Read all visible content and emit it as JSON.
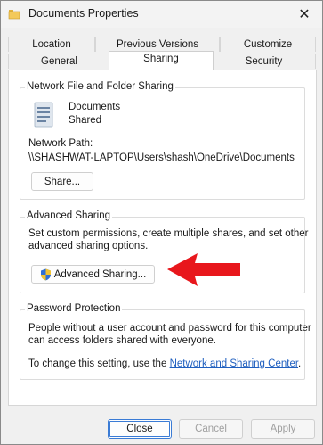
{
  "window": {
    "title": "Documents Properties",
    "close_glyph": "✕"
  },
  "tabs": {
    "row1": [
      "Location",
      "Previous Versions",
      "Customize"
    ],
    "row2": [
      "General",
      "Sharing",
      "Security"
    ],
    "active": "Sharing"
  },
  "network_sharing": {
    "group_label": "Network File and Folder Sharing",
    "folder_name": "Documents",
    "folder_status": "Shared",
    "path_label": "Network Path:",
    "path_value": "\\\\SHASHWAT-LAPTOP\\Users\\shash\\OneDrive\\Documents",
    "share_button": "Share..."
  },
  "advanced_sharing": {
    "group_label": "Advanced Sharing",
    "description_line1": "Set custom permissions, create multiple shares, and set other",
    "description_line2": "advanced sharing options.",
    "button": "Advanced Sharing..."
  },
  "password_protection": {
    "group_label": "Password Protection",
    "line1": "People without a user account and password for this computer",
    "line2": "can access folders shared with everyone.",
    "change_prefix": "To change this setting, use the",
    "link_text": "Network and Sharing Center",
    "change_suffix": "."
  },
  "footer": {
    "close": "Close",
    "cancel": "Cancel",
    "apply": "Apply"
  },
  "colors": {
    "accent": "#3a7bd5",
    "link": "#1f5fbf",
    "annotation_arrow": "#e8171c"
  }
}
